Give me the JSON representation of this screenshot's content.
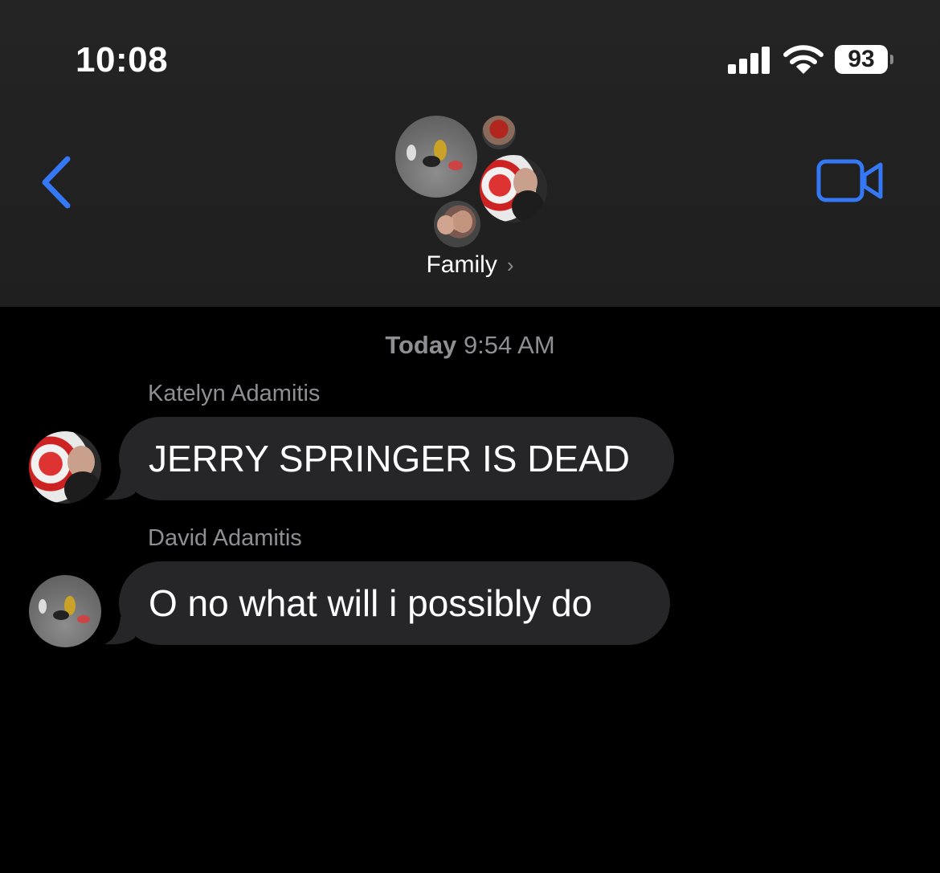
{
  "status_bar": {
    "time": "10:08",
    "battery_percent": "93",
    "signal_bars": 4,
    "icons": [
      "signal-icon",
      "wifi-icon",
      "battery-icon"
    ]
  },
  "nav": {
    "back_icon": "chevron-left-icon",
    "group_name": "Family",
    "group_chevron": "›",
    "video_icon": "video-camera-icon",
    "accent_color": "#3478f6"
  },
  "conversation": {
    "timestamp_day": "Today",
    "timestamp_time": "9:54 AM",
    "messages": [
      {
        "sender": "Katelyn Adamitis",
        "text": "JERRY SPRINGER IS DEAD"
      },
      {
        "sender": "David Adamitis",
        "text": "O no what will i possibly do"
      }
    ]
  },
  "colors": {
    "bubble_gray": "#262629",
    "secondary_text": "#8e8e93",
    "background": "#000000"
  }
}
